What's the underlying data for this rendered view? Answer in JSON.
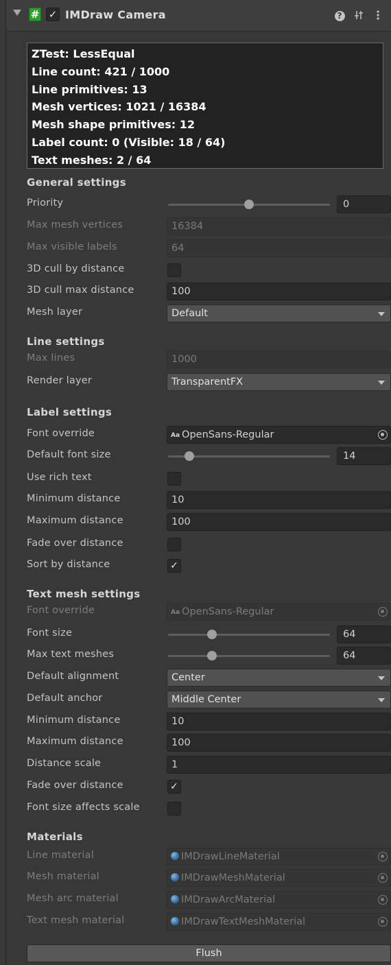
{
  "header": {
    "title": "IMDraw Camera",
    "enabled": true,
    "help_icon": "help-icon",
    "preset_icon": "preset-sliders-icon",
    "menu_icon": "kebab-menu-icon",
    "script_icon_glyph": "#"
  },
  "info": [
    "ZTest: LessEqual",
    "Line count: 421 / 1000",
    "Line primitives: 13",
    "Mesh vertices: 1021 / 16384",
    "Mesh shape primitives: 12",
    "Label count: 0 (Visible: 18 / 64)",
    "Text meshes: 2 / 64"
  ],
  "general": {
    "title": "General settings",
    "priority": {
      "label": "Priority",
      "value": "0",
      "level": 0.5
    },
    "max_mesh_vertices": {
      "label": "Max mesh vertices",
      "value": "16384"
    },
    "max_visible_labels": {
      "label": "Max visible labels",
      "value": "64"
    },
    "cull_3d": {
      "label": "3D cull by distance",
      "checked": false
    },
    "cull_max_distance": {
      "label": "3D cull max distance",
      "value": "100"
    },
    "mesh_layer": {
      "label": "Mesh layer",
      "value": "Default"
    }
  },
  "line": {
    "title": "Line settings",
    "max_lines": {
      "label": "Max lines",
      "value": "1000"
    },
    "render_layer": {
      "label": "Render layer",
      "value": "TransparentFX"
    }
  },
  "label": {
    "title": "Label settings",
    "font_override": {
      "label": "Font override",
      "value": "OpenSans-Regular",
      "icon_text": "Aa"
    },
    "default_font_size": {
      "label": "Default font size",
      "value": "14",
      "level": 0.13
    },
    "use_rich_text": {
      "label": "Use rich text",
      "checked": false
    },
    "minimum_distance": {
      "label": "Minimum distance",
      "value": "10"
    },
    "maximum_distance": {
      "label": "Maximum distance",
      "value": "100"
    },
    "fade_over_distance": {
      "label": "Fade over distance",
      "checked": false
    },
    "sort_by_distance": {
      "label": "Sort by distance",
      "checked": true
    }
  },
  "text_mesh": {
    "title": "Text mesh settings",
    "font_override": {
      "label": "Font override",
      "value": "OpenSans-Regular",
      "icon_text": "Aa"
    },
    "font_size": {
      "label": "Font size",
      "value": "64",
      "level": 0.27
    },
    "max_text_meshes": {
      "label": "Max text meshes",
      "value": "64",
      "level": 0.27
    },
    "default_alignment": {
      "label": "Default alignment",
      "value": "Center"
    },
    "default_anchor": {
      "label": "Default anchor",
      "value": "Middle Center"
    },
    "minimum_distance": {
      "label": "Minimum distance",
      "value": "10"
    },
    "maximum_distance": {
      "label": "Maximum distance",
      "value": "100"
    },
    "distance_scale": {
      "label": "Distance scale",
      "value": "1"
    },
    "fade_over_distance": {
      "label": "Fade over distance",
      "checked": true
    },
    "font_size_affects_scale": {
      "label": "Font size affects scale",
      "checked": false
    }
  },
  "materials": {
    "title": "Materials",
    "line_material": {
      "label": "Line material",
      "value": "IMDrawLineMaterial"
    },
    "mesh_material": {
      "label": "Mesh material",
      "value": "IMDrawMeshMaterial"
    },
    "mesh_arc_material": {
      "label": "Mesh arc material",
      "value": "IMDrawArcMaterial"
    },
    "text_mesh_material": {
      "label": "Text mesh material",
      "value": "IMDrawTextMeshMaterial"
    }
  },
  "flush_label": "Flush",
  "check_glyph": "✓"
}
